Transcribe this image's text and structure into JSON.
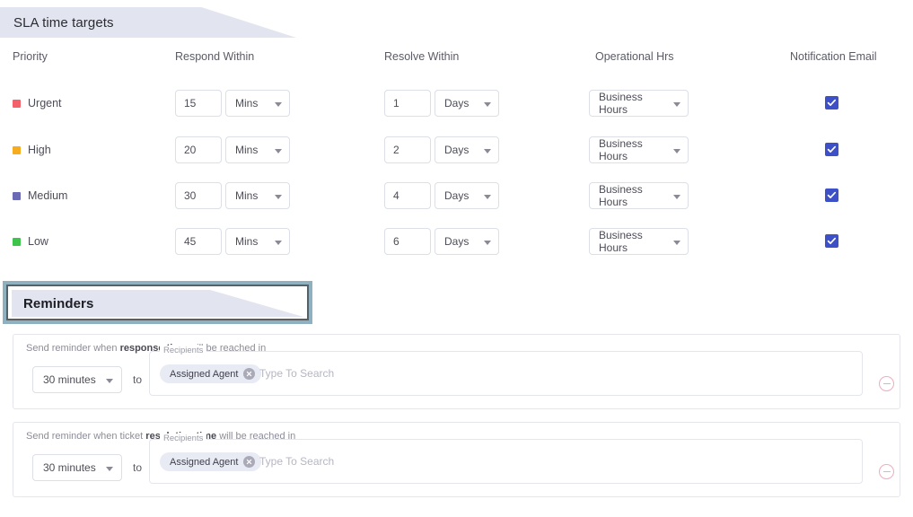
{
  "sla_section": {
    "title": "SLA time targets",
    "columns": {
      "priority": "Priority",
      "respond": "Respond Within",
      "resolve": "Resolve Within",
      "operational": "Operational Hrs",
      "notification": "Notification Email"
    },
    "rows": [
      {
        "priority": "Urgent",
        "color": "#f4616a",
        "respond_value": "15",
        "respond_unit": "Mins",
        "resolve_value": "1",
        "resolve_unit": "Days",
        "operational_hours": "Business Hours",
        "notification_checked": true
      },
      {
        "priority": "High",
        "color": "#f7ab1e",
        "respond_value": "20",
        "respond_unit": "Mins",
        "resolve_value": "2",
        "resolve_unit": "Days",
        "operational_hours": "Business Hours",
        "notification_checked": true
      },
      {
        "priority": "Medium",
        "color": "#6b6bb5",
        "respond_value": "30",
        "respond_unit": "Mins",
        "resolve_value": "4",
        "resolve_unit": "Days",
        "operational_hours": "Business Hours",
        "notification_checked": true
      },
      {
        "priority": "Low",
        "color": "#3ec44a",
        "respond_value": "45",
        "respond_unit": "Mins",
        "resolve_value": "6",
        "resolve_unit": "Days",
        "operational_hours": "Business Hours",
        "notification_checked": true
      }
    ]
  },
  "reminders_section": {
    "title": "Reminders",
    "selected": true,
    "cards": [
      {
        "text_prefix": "Send reminder when ",
        "text_bold": "response time",
        "text_suffix": " will be reached in",
        "delay": "30 minutes",
        "to_label": "to",
        "recipients_legend": "Recipients",
        "chip": "Assigned Agent",
        "search_placeholder": "Type To Search",
        "remove_icon": "minus-circle-icon"
      },
      {
        "text_prefix": "Send reminder when ticket ",
        "text_bold": "resolution time",
        "text_suffix": " will be reached in",
        "delay": "30 minutes",
        "to_label": "to",
        "recipients_legend": "Recipients",
        "chip": "Assigned Agent",
        "search_placeholder": "Type To Search",
        "remove_icon": "minus-circle-icon"
      }
    ]
  },
  "theme": {
    "banner_bg": "#e2e5ef",
    "checkbox_blue": "#3d50c8",
    "selection_border": "#8fb0bf",
    "remove_pink": "#f5a8bc",
    "chip_bg": "#e8eaf4"
  }
}
